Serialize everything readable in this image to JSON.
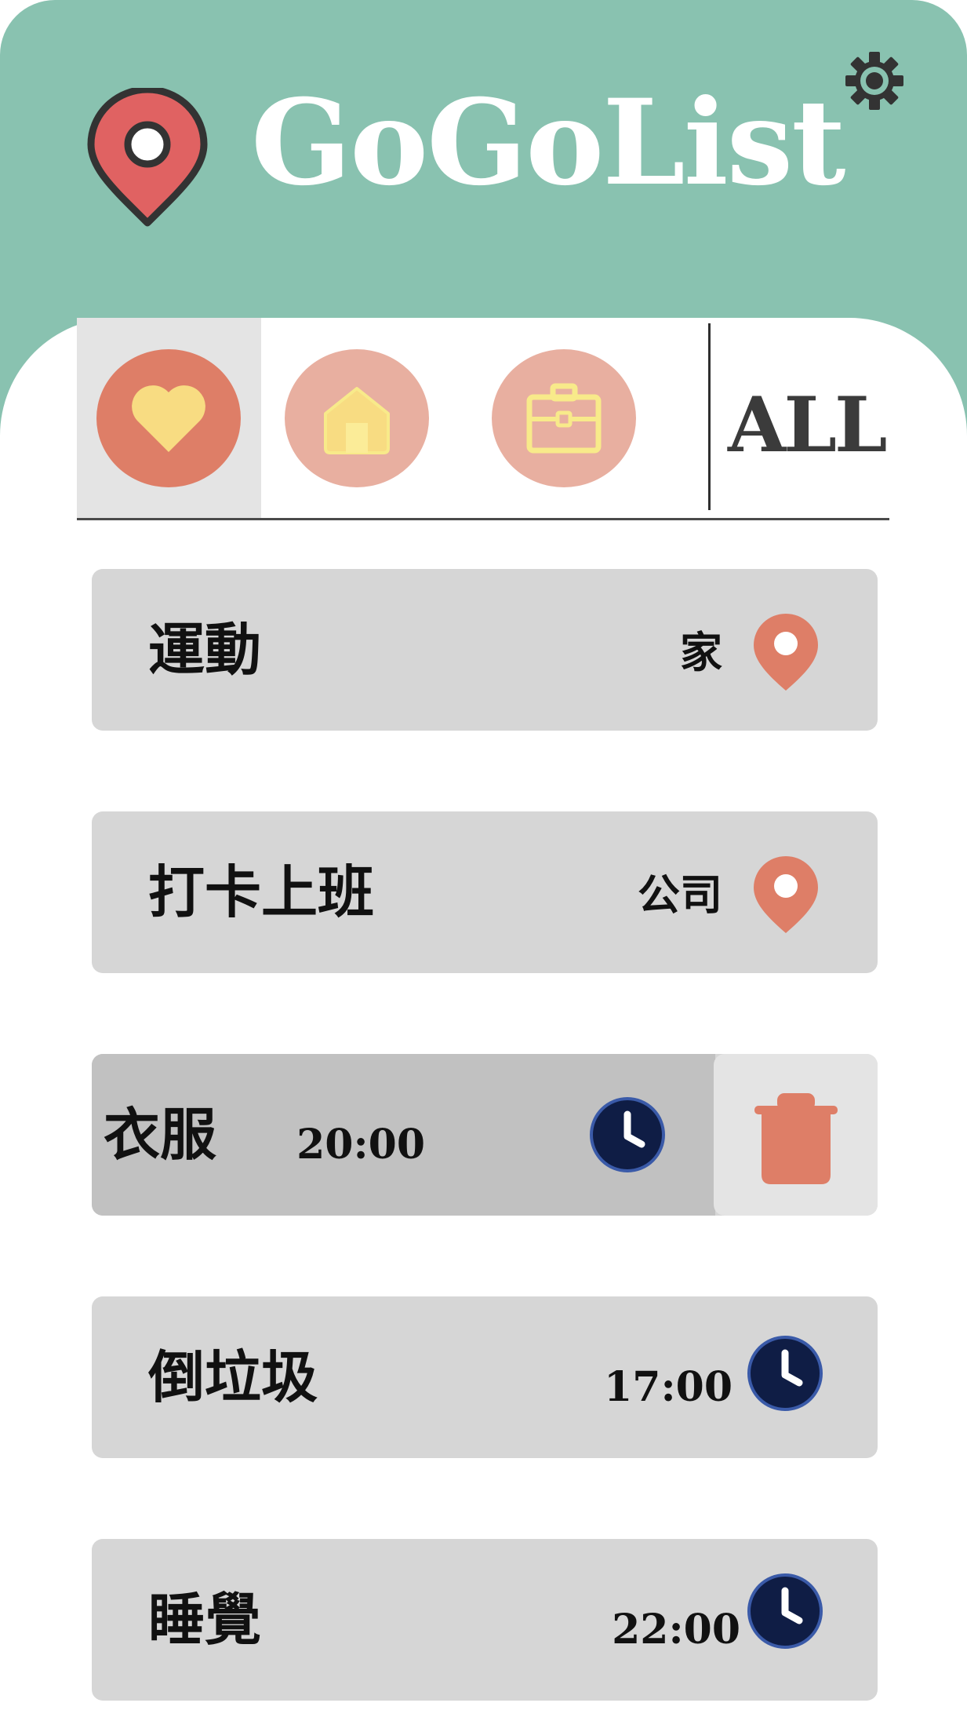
{
  "app": {
    "title": "GoGoList",
    "logo_icon": "map-pin-icon",
    "settings_icon": "gear-icon"
  },
  "colors": {
    "header": "#89c2b0",
    "accent": "#de7e67",
    "accent_light": "#e8afa0",
    "icon_yellow": "#f8dc82",
    "clock": "#0f1d45",
    "clock_ring": "#3a5aa8",
    "card": "#d6d6d6",
    "card_swiped": "#c1c1c1",
    "tab_active": "#e4e4e4"
  },
  "filters": {
    "items": [
      {
        "name": "favorites",
        "icon": "heart-icon",
        "active": true
      },
      {
        "name": "home",
        "icon": "house-icon",
        "active": false
      },
      {
        "name": "work",
        "icon": "briefcase-icon",
        "active": false
      }
    ],
    "all_label": "ALL"
  },
  "tasks": [
    {
      "name": "運動",
      "type": "location",
      "location": "家",
      "icon": "map-pin-icon"
    },
    {
      "name": "打卡上班",
      "type": "location",
      "location": "公司",
      "icon": "map-pin-icon"
    },
    {
      "name": "衣服",
      "type": "time",
      "time": "20:00",
      "icon": "clock-icon",
      "swiped": true,
      "action_icon": "trash-icon"
    },
    {
      "name": "倒垃圾",
      "type": "time",
      "time": "17:00",
      "icon": "clock-icon"
    },
    {
      "name": "睡覺",
      "type": "time",
      "time": "22:00",
      "icon": "clock-icon"
    }
  ]
}
